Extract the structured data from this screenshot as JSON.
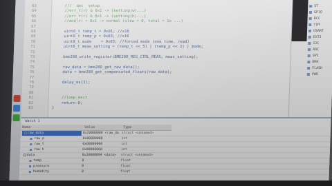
{
  "editor": {
    "lines": [
      {
        "num": "63",
        "text": "    ///  dec  setup",
        "cls": "c"
      },
      {
        "num": "64",
        "text": "    //err_t(r) & 0x1 -> (setting(w)...)",
        "cls": "c"
      },
      {
        "num": "65",
        "text": "    //err_t(r) & 0x1 -> (setting(h)...)",
        "cls": "c"
      },
      {
        "num": "66",
        "text": "    //mod(r) = 0x1 -> normal (slew = 0, total = 1e ...)",
        "cls": "c"
      },
      {
        "num": "67",
        "text": "",
        "cls": ""
      },
      {
        "num": "68",
        "text": "    uint8_t temp_t = 0x01; //x16",
        "cls": "k"
      },
      {
        "num": "69",
        "text": "    uint8_t temp_p = 0x03; //x16",
        "cls": "k"
      },
      {
        "num": "70",
        "text": "    uint8_t mode    = 0x03; //forced mode (one time, read)",
        "cls": "k"
      },
      {
        "num": "71",
        "text": "    uint8_t meas_setting = (temp_t << 5) | (temp_p << 2) | mode;",
        "cls": "k"
      },
      {
        "num": "72",
        "text": "",
        "cls": ""
      },
      {
        "num": "73",
        "text": "    bme280_write_register(BME280_REG_CTRL_MEAS, meas_setting);",
        "cls": "k"
      },
      {
        "num": "74",
        "text": "",
        "cls": ""
      },
      {
        "num": "75",
        "text": "    raw_data = bme280_get_raw_data();",
        "cls": "k"
      },
      {
        "num": "76",
        "text": "    data = bme280_get_compensated_floats(raw_data);",
        "cls": "k"
      },
      {
        "num": "77",
        "text": "",
        "cls": ""
      },
      {
        "num": "78",
        "text": "    delay_ms(1);",
        "cls": "k"
      },
      {
        "num": "79",
        "text": "",
        "cls": ""
      },
      {
        "num": "80",
        "text": "",
        "cls": ""
      },
      {
        "num": "81",
        "text": "    //loop exit",
        "cls": "c"
      },
      {
        "num": "82",
        "text": "    return 0;",
        "cls": "k"
      },
      {
        "num": "83",
        "text": "}",
        "cls": "k"
      }
    ]
  },
  "side_panel": {
    "items": [
      "ST",
      "GPIO",
      "RCC",
      "TIM",
      "USART",
      "EXTI",
      "I2C",
      "ADC",
      "SPI",
      "DMA",
      "FLASH",
      "PWR"
    ]
  },
  "watch": {
    "title": "Watch 1",
    "headers": {
      "name": "Name",
      "value": "Value",
      "type": "Type"
    },
    "rows": [
      {
        "name": "raw_data",
        "value": "0x20000088 <raw_data>",
        "type": "struct <unnamed>",
        "level": 0,
        "sel": true
      },
      {
        "name": "raw_p",
        "value": "0x00000000",
        "type": "int",
        "level": 1,
        "sel": false
      },
      {
        "name": "raw_t",
        "value": "0x00000000",
        "type": "int",
        "level": 1,
        "sel": false
      },
      {
        "name": "raw_h",
        "value": "0x00000000",
        "type": "int",
        "level": 1,
        "sel": false
      },
      {
        "name": "data",
        "value": "0x20000094 <data>",
        "type": "struct <unnamed>",
        "level": 0,
        "sel": false
      },
      {
        "name": "temp",
        "value": "0",
        "type": "float",
        "level": 1,
        "sel": false
      },
      {
        "name": "pressure",
        "value": "0",
        "type": "float",
        "level": 1,
        "sel": false
      },
      {
        "name": "humidity",
        "value": "0",
        "type": "float",
        "level": 1,
        "sel": false
      }
    ]
  },
  "colors": {
    "selection": "#3b6fc4",
    "comment": "#5aa05a",
    "code": "#3f5f9a"
  }
}
